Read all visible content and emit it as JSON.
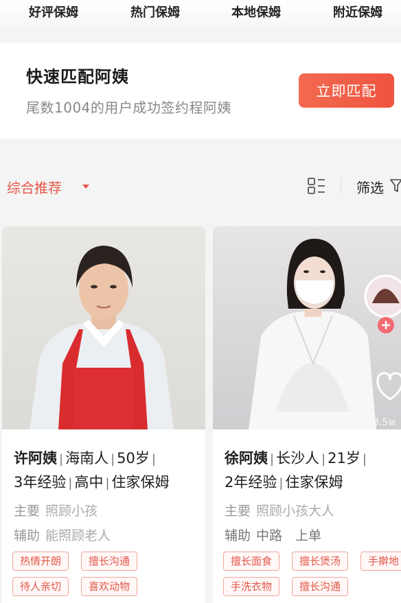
{
  "top_tabs": [
    "好评保姆",
    "热门保姆",
    "本地保姆",
    "附近保姆"
  ],
  "banner": {
    "title": "快速匹配阿姨",
    "subtitle": "尾数1004的用户成功签约程阿姨",
    "button_label": "立即匹配"
  },
  "sortbar": {
    "sort_label": "综合推荐",
    "filter_label": "筛选"
  },
  "cards": [
    {
      "name": "许阿姨",
      "origin": "海南人",
      "age": "50岁",
      "experience": "3年经验",
      "education": "高中",
      "job_type": "住家保姆",
      "main_label": "主要",
      "main_value": "照顾小孩",
      "aux_label": "辅助",
      "aux_value": "能照顾老人",
      "tags": [
        "热情开朗",
        "擅长沟通",
        "待人亲切",
        "喜欢动物"
      ]
    },
    {
      "name": "徐阿姨",
      "origin": "长沙人",
      "age": "21岁",
      "experience": "2年经验",
      "job_type": "住家保姆",
      "main_label": "主要",
      "main_value": "照顾小孩大人",
      "aux_label": "辅助",
      "aux_value": "中路　上单",
      "tags": [
        "擅长面食",
        "擅长煲汤",
        "手擀地",
        "手洗衣物",
        "擅长沟通"
      ],
      "photo_count": "3.5w"
    }
  ],
  "colors": {
    "accent": "#e4574a",
    "button": "#ef5440",
    "text": "#1e1e1e",
    "muted": "#999999"
  }
}
